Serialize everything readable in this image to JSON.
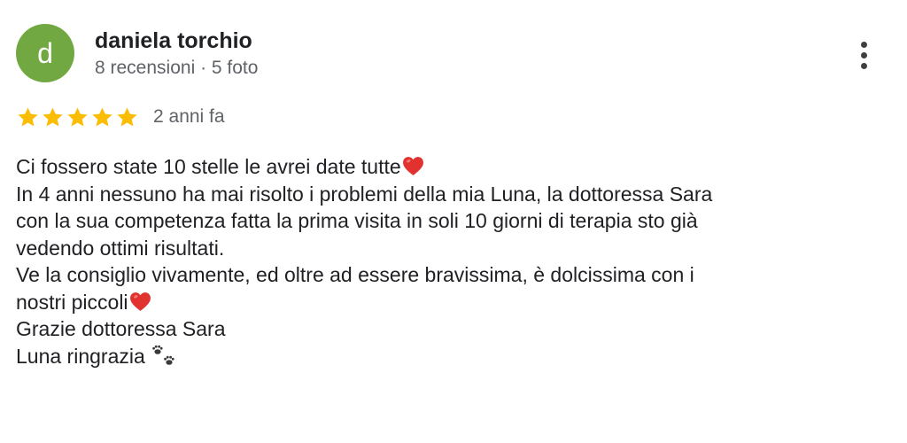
{
  "review": {
    "author": {
      "initial": "d",
      "name": "daniela torchio",
      "meta": "8 recensioni · 5 foto",
      "avatar_color": "#72a841"
    },
    "rating": {
      "stars": 5,
      "max": 5,
      "star_color": "#fbbc04",
      "age": "2 anni fa"
    },
    "more_menu_icon": "more-vert-icon",
    "body": {
      "line1": "Ci fossero state 10 stelle le avrei date tutte",
      "line1_emoji": "red-heart-icon",
      "line2": "In 4 anni nessuno ha mai risolto i problemi della mia Luna, la dottoressa Sara",
      "line3": "con la sua competenza fatta la prima visita in soli 10 giorni di terapia sto già",
      "line4": "vedendo ottimi risultati.",
      "line5": "Ve la consiglio vivamente, ed oltre ad essere bravissima, è dolcissima con i",
      "line6": "nostri piccoli",
      "line6_emoji": "red-heart-icon",
      "line7": "Grazie dottoressa Sara",
      "line8": "Luna ringrazia",
      "line8_emoji": "paw-prints-icon"
    }
  }
}
